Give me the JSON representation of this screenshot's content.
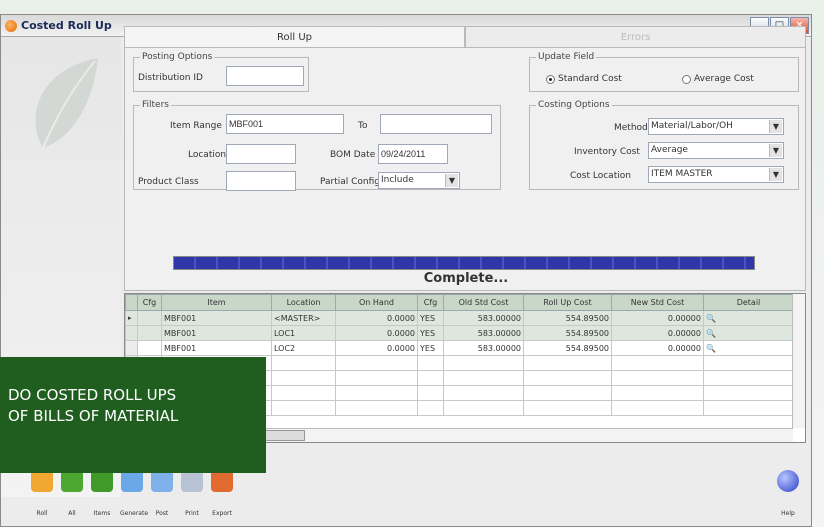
{
  "window": {
    "title": "Costed Roll Up",
    "buttons": [
      "_",
      "□",
      "✕"
    ]
  },
  "tabs": [
    {
      "label": "Roll Up",
      "active": true
    },
    {
      "label": "Errors",
      "active": false
    }
  ],
  "posting_options": {
    "legend": "Posting Options",
    "distribution_label": "Distribution ID",
    "distribution_value": ""
  },
  "update_field": {
    "legend": "Update Field",
    "standard_label": "Standard Cost",
    "average_label": "Average Cost",
    "selected": "Standard Cost"
  },
  "filters": {
    "legend": "Filters",
    "item_range_label": "Item Range",
    "item_range_from": "MBF001",
    "to_label": "To",
    "item_range_to": "",
    "location_label": "Location",
    "location_value": "",
    "bom_date_label": "BOM Date",
    "bom_date_value": "09/24/2011",
    "product_class_label": "Product Class",
    "product_class_value": "",
    "partial_config_label": "Partial Config",
    "partial_config_value": "Include"
  },
  "costing_options": {
    "legend": "Costing Options",
    "method_label": "Method",
    "method_value": "Material/Labor/OH",
    "inventory_cost_label": "Inventory Cost",
    "inventory_cost_value": "Average",
    "cost_location_label": "Cost Location",
    "cost_location_value": "ITEM MASTER"
  },
  "progress": {
    "fraction": 1.0,
    "status": "Complete..."
  },
  "grid": {
    "headers": [
      "Cfg",
      "Item",
      "Location",
      "On Hand",
      "Cfg",
      "Old Std Cost",
      "Roll Up Cost",
      "New Std Cost",
      "Detail"
    ],
    "rows": [
      {
        "indicator": "▸",
        "cfg": "",
        "item": "MBF001",
        "location": "<MASTER>",
        "on_hand": "0.0000",
        "cfg2": "YES",
        "old_std": "583.00000",
        "rollup": "554.89500",
        "new_std": "0.00000"
      },
      {
        "indicator": "",
        "cfg": "",
        "item": "MBF001",
        "location": "LOC1",
        "on_hand": "0.0000",
        "cfg2": "YES",
        "old_std": "583.00000",
        "rollup": "554.89500",
        "new_std": "0.00000"
      },
      {
        "indicator": "",
        "cfg": "",
        "item": "MBF001",
        "location": "LOC2",
        "on_hand": "0.0000",
        "cfg2": "YES",
        "old_std": "583.00000",
        "rollup": "554.89500",
        "new_std": "0.00000"
      }
    ]
  },
  "toolbar": [
    {
      "label": "Roll",
      "icon": "home-icon",
      "color": "#f0a830"
    },
    {
      "label": "All",
      "icon": "all-arrow-icon",
      "color": "#4da832"
    },
    {
      "label": "Items",
      "icon": "items-arrow-icon",
      "color": "#3f9a2a"
    },
    {
      "label": "Generate",
      "icon": "globe-icon",
      "color": "#6aa8e8"
    },
    {
      "label": "Post",
      "icon": "envelope-icon",
      "color": "#7fb0ea"
    },
    {
      "label": "Print",
      "icon": "printer-icon",
      "color": "#b8c4d6"
    },
    {
      "label": "Export",
      "icon": "export-icon",
      "color": "#e06a30"
    }
  ],
  "help": {
    "label": "Help",
    "icon": "help-icon"
  },
  "banner": {
    "line1": "DO COSTED ROLL UPS",
    "line2": "OF BILLS OF MATERIAL"
  }
}
